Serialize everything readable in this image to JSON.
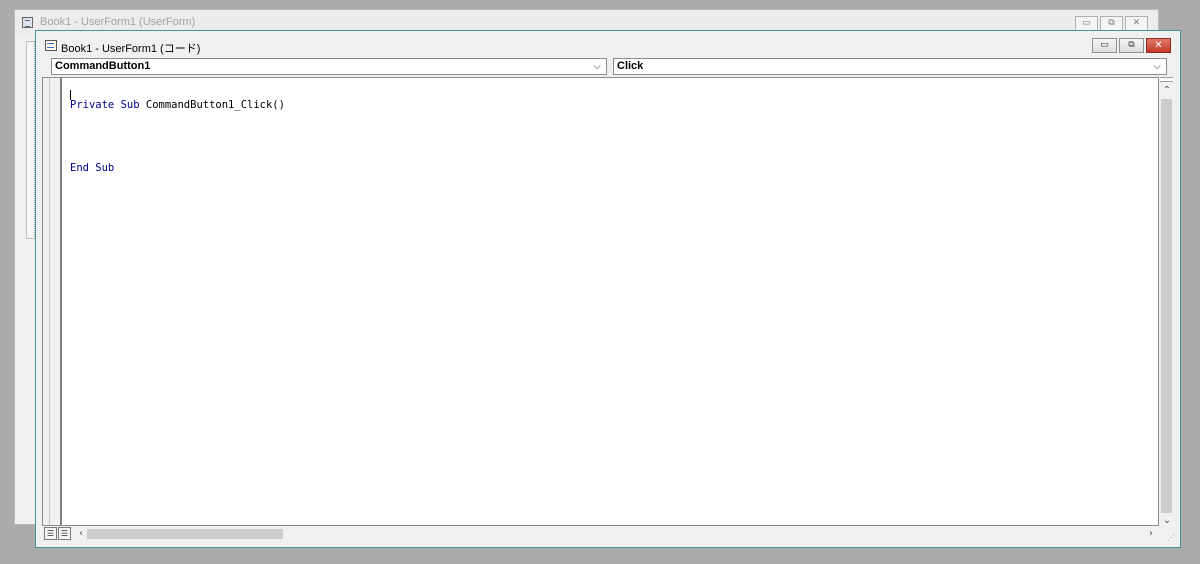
{
  "back_window": {
    "title": "Book1 - UserForm1 (UserForm)",
    "controls": {
      "minimize": "▭",
      "restore": "⧉",
      "close": "✕"
    }
  },
  "code_window": {
    "title": "Book1 - UserForm1 (コード)",
    "controls": {
      "minimize": "▭",
      "restore": "⧉",
      "close": "✕"
    },
    "object_combo": {
      "value": "CommandButton1"
    },
    "procedure_combo": {
      "value": "Click"
    },
    "code_lines": [
      {
        "kw": "Private Sub",
        "rest": " CommandButton1_Click()"
      },
      {
        "kw": "",
        "rest": ""
      },
      {
        "kw": "End Sub",
        "rest": ""
      }
    ],
    "view_buttons": {
      "procedure_view": "☰",
      "full_module_view": "☰"
    }
  }
}
